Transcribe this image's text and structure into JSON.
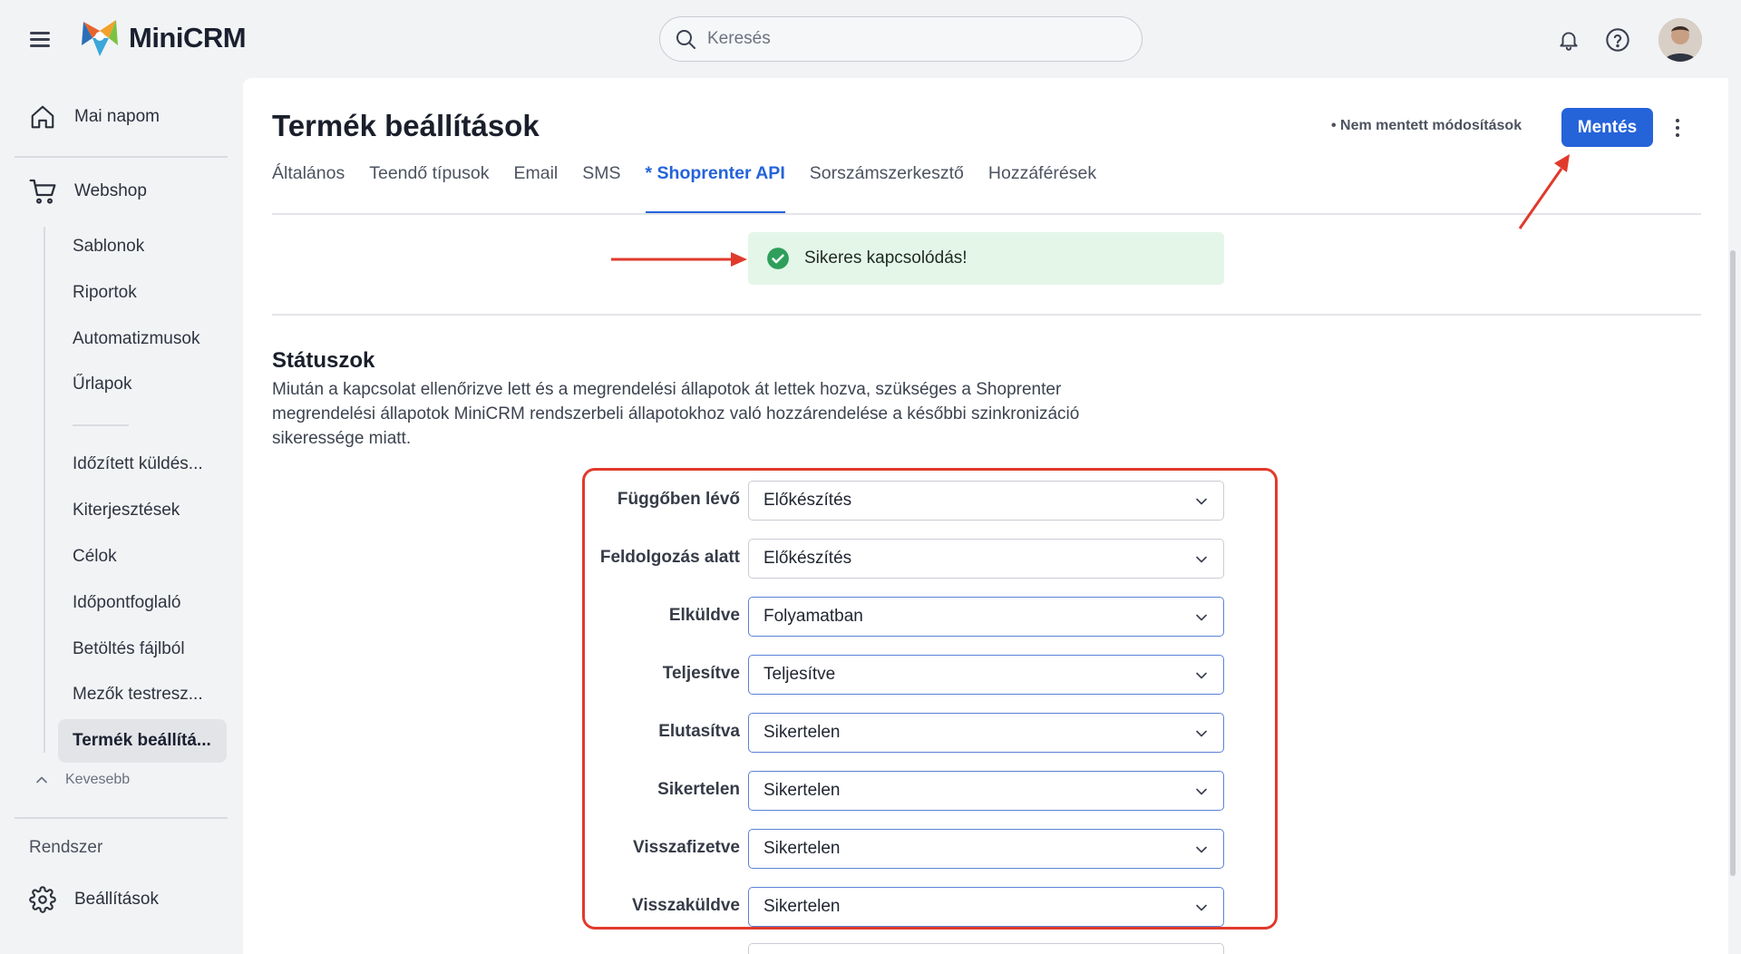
{
  "app": {
    "name": "MiniCRM"
  },
  "search": {
    "placeholder": "Keresés"
  },
  "sidebar": {
    "today": "Mai napom",
    "webshop": "Webshop",
    "sub_items": [
      "Sablonok",
      "Riportok",
      "Automatizmusok",
      "Űrlapok",
      "Időzített küldés...",
      "Kiterjesztések",
      "Célok",
      "Időpontfoglaló",
      "Betöltés fájlból",
      "Mezők testresz...",
      "Termék beállítá..."
    ],
    "less": "Kevesebb",
    "section_label": "Rendszer",
    "settings": "Beállítások"
  },
  "page": {
    "title": "Termék beállítások",
    "unsaved": "• Nem mentett módosítások",
    "save_label": "Mentés"
  },
  "tabs": [
    "Általános",
    "Teendő típusok",
    "Email",
    "SMS",
    "* Shoprenter API",
    "Sorszámszerkesztő",
    "Hozzáférések"
  ],
  "active_tab": "* Shoprenter API",
  "toast": {
    "message": "Sikeres kapcsolódás!"
  },
  "statuses": {
    "title": "Státuszok",
    "description": "Miután a kapcsolat ellenőrizve lett és a megrendelési állapotok át lettek hozva, szükséges a Shoprenter megrendelési állapotok MiniCRM rendszerbeli állapotokhoz való hozzárendelése a későbbi szinkronizáció sikeressége miatt.",
    "rows": [
      {
        "label": "Függőben lévő",
        "value": "Előkészítés"
      },
      {
        "label": "Feldolgozás alatt",
        "value": "Előkészítés"
      },
      {
        "label": "Elküldve",
        "value": "Folyamatban"
      },
      {
        "label": "Teljesítve",
        "value": "Teljesítve"
      },
      {
        "label": "Elutasítva",
        "value": "Sikertelen"
      },
      {
        "label": "Sikertelen",
        "value": "Sikertelen"
      },
      {
        "label": "Visszafizetve",
        "value": "Sikertelen"
      },
      {
        "label": "Visszaküldve",
        "value": "Sikertelen"
      }
    ]
  },
  "colors": {
    "accent": "#2563d9",
    "success": "#2e9f5a",
    "annotation": "#e03a2c"
  }
}
